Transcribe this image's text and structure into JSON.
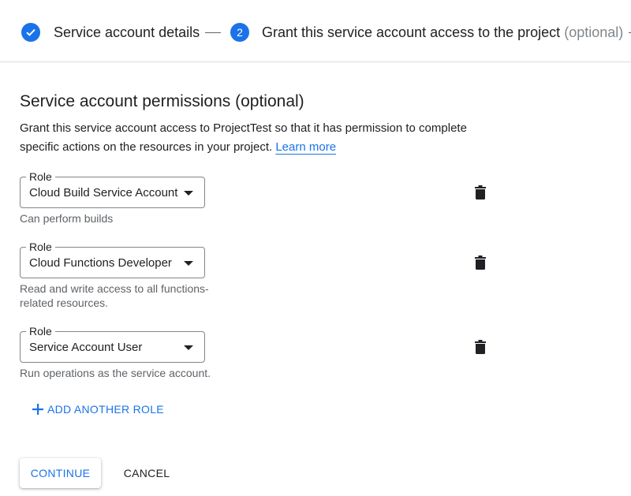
{
  "stepper": {
    "step1": {
      "label": "Service account details",
      "state": "completed"
    },
    "step2": {
      "number": "2",
      "label": "Grant this service account access to the project",
      "optional": "(optional)"
    }
  },
  "section": {
    "title": "Service account permissions (optional)",
    "description": "Grant this service account access to ProjectTest so that it has permission to complete specific actions on the resources in your project.",
    "learn_more": "Learn more"
  },
  "roles": [
    {
      "label": "Role",
      "value": "Cloud Build Service Account",
      "hint": "Can perform builds"
    },
    {
      "label": "Role",
      "value": "Cloud Functions Developer",
      "hint": "Read and write access to all functions-related resources."
    },
    {
      "label": "Role",
      "value": "Service Account User",
      "hint": "Run operations as the service account."
    }
  ],
  "actions": {
    "add_role": "ADD ANOTHER ROLE",
    "continue": "CONTINUE",
    "cancel": "CANCEL"
  },
  "colors": {
    "accent": "#1a73e8",
    "text": "#202124",
    "secondary_text": "#5f6368",
    "divider": "#dadce0"
  }
}
